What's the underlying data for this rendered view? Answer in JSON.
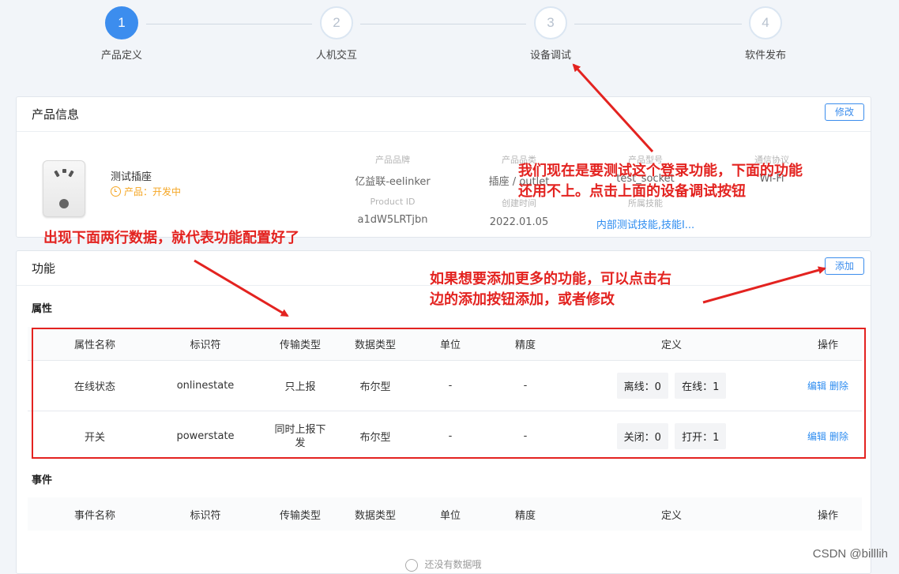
{
  "steps": [
    {
      "num": "1",
      "label": "产品定义",
      "active": true
    },
    {
      "num": "2",
      "label": "人机交互",
      "active": false
    },
    {
      "num": "3",
      "label": "设备调试",
      "active": false
    },
    {
      "num": "4",
      "label": "软件发布",
      "active": false
    }
  ],
  "product_card": {
    "title": "产品信息",
    "edit_label": "修改",
    "name": "测试插座",
    "status": "产品：开发中",
    "fields": [
      {
        "key": "产品品牌",
        "value": "亿益联-eelinker"
      },
      {
        "key": "产品品类",
        "value": "插座 / outlet"
      },
      {
        "key": "产品型号",
        "value": "test_socket"
      },
      {
        "key": "通信协议",
        "value": "Wi-Fi"
      },
      {
        "key": "Product ID",
        "value": "a1dW5LRTjbn"
      },
      {
        "key": "创建时间",
        "value": "2022.01.05"
      },
      {
        "key": "所属技能",
        "value": "内部测试技能,技能I..."
      }
    ]
  },
  "function_card": {
    "title": "功能",
    "add_label": "添加",
    "attr_title": "属性",
    "attr_headers": [
      "属性名称",
      "标识符",
      "传输类型",
      "数据类型",
      "单位",
      "精度",
      "定义",
      "操作"
    ],
    "attr_rows": [
      {
        "name": "在线状态",
        "id": "onlinestate",
        "transfer": "只上报",
        "type": "布尔型",
        "unit": "-",
        "precision": "-",
        "def0": "离线：0",
        "def1": "在线：1",
        "edit": "编辑",
        "del": "删除"
      },
      {
        "name": "开关",
        "id": "powerstate",
        "transfer": "同时上报下发",
        "type": "布尔型",
        "unit": "-",
        "precision": "-",
        "def0": "关闭：0",
        "def1": "打开：1",
        "edit": "编辑",
        "del": "删除"
      }
    ],
    "event_title": "事件",
    "event_headers": [
      "事件名称",
      "标识符",
      "传输类型",
      "数据类型",
      "单位",
      "精度",
      "定义",
      "操作"
    ],
    "empty_text": "还没有数据哦"
  },
  "annotations": {
    "note_top": [
      "我们现在是要测试这个登录功能，下面的功能",
      "还用不上。点击上面的设备调试按钮"
    ],
    "note_mid": "出现下面两行数据，就代表功能配置好了",
    "note_right": [
      "如果想要添加更多的功能，可以点击右",
      "边的添加按钮添加，或者修改"
    ],
    "arrow_color": "#e32320"
  },
  "watermark": "CSDN @billlih"
}
